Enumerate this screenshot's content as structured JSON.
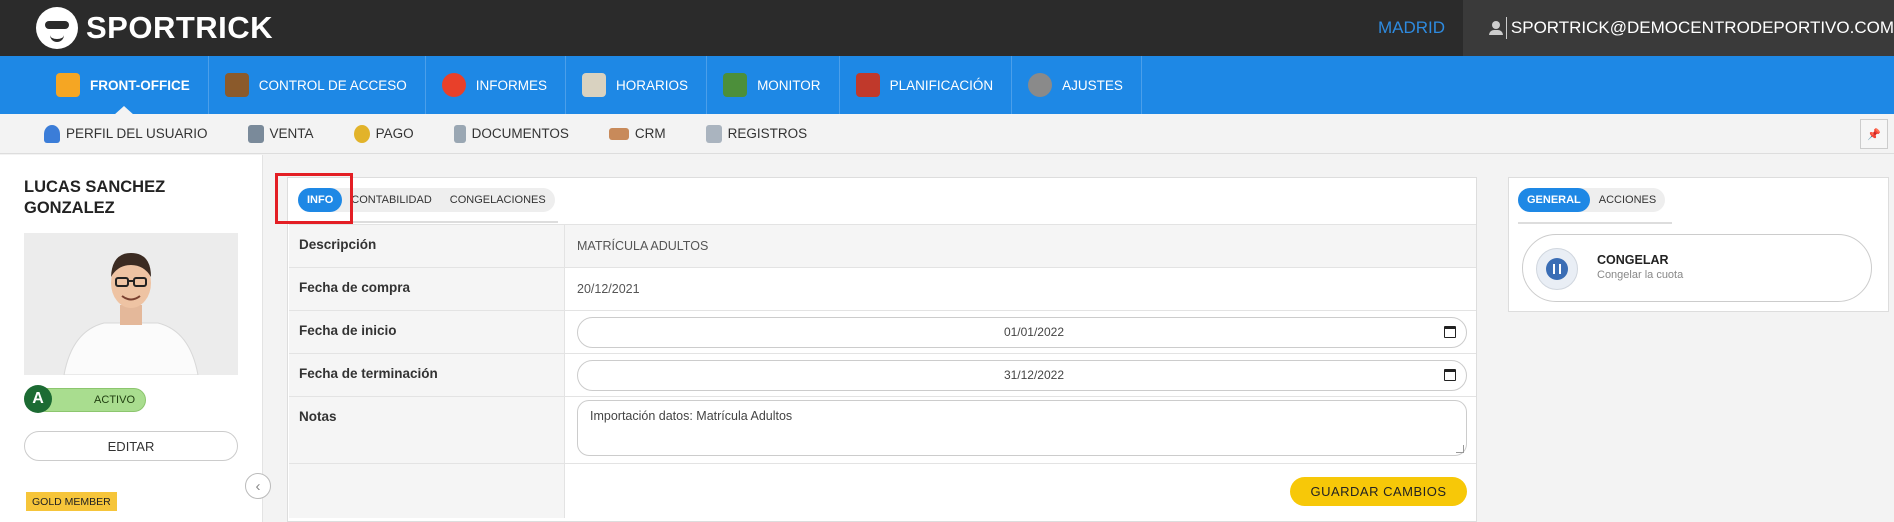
{
  "header": {
    "brand": "SPORTRICK",
    "city": "MADRID",
    "user_email": "SPORTRICK@DEMOCENTRODEPORTIVO.COM"
  },
  "main_nav": [
    {
      "label": "FRONT-OFFICE",
      "icon": "front-office-icon",
      "color": "#f5a623",
      "active": true
    },
    {
      "label": "CONTROL DE ACCESO",
      "icon": "access-control-icon",
      "color": "#8b5a2b",
      "active": false
    },
    {
      "label": "INFORMES",
      "icon": "reports-icon",
      "color": "#e8402a",
      "active": false
    },
    {
      "label": "HORARIOS",
      "icon": "schedule-icon",
      "color": "#d9d2c0",
      "active": false
    },
    {
      "label": "MONITOR",
      "icon": "monitor-icon",
      "color": "#4c8f3a",
      "active": false
    },
    {
      "label": "PLANIFICACIÓN",
      "icon": "calendar-icon",
      "color": "#c0392b",
      "active": false
    },
    {
      "label": "AJUSTES",
      "icon": "settings-icon",
      "color": "#8a8a8a",
      "active": false
    }
  ],
  "sub_nav": [
    {
      "label": "PERFIL DEL USUARIO",
      "icon": "user-profile-icon",
      "color": "#3b7dd8"
    },
    {
      "label": "VENTA",
      "icon": "cash-register-icon",
      "color": "#7a8a9a"
    },
    {
      "label": "PAGO",
      "icon": "coins-icon",
      "color": "#e2b32a"
    },
    {
      "label": "DOCUMENTOS",
      "icon": "documents-icon",
      "color": "#9aa7b3"
    },
    {
      "label": "CRM",
      "icon": "handshake-icon",
      "color": "#c88a5a"
    },
    {
      "label": "REGISTROS",
      "icon": "log-icon",
      "color": "#aab4bf"
    }
  ],
  "profile": {
    "name": "LUCAS SANCHEZ GONZALEZ",
    "status_letter": "A",
    "status_label": "ACTIVO",
    "edit_label": "EDITAR",
    "badge": "GOLD MEMBER"
  },
  "detail": {
    "tabs": [
      {
        "label": "INFO",
        "active": true
      },
      {
        "label": "CONTABILIDAD",
        "active": false
      },
      {
        "label": "CONGELACIONES",
        "active": false
      }
    ],
    "fields": {
      "description_label": "Descripción",
      "description_value": "MATRÍCULA ADULTOS",
      "purchase_label": "Fecha de compra",
      "purchase_value": "20/12/2021",
      "start_label": "Fecha de inicio",
      "start_value": "01/01/2022",
      "end_label": "Fecha de terminación",
      "end_value": "31/12/2022",
      "notes_label": "Notas",
      "notes_value": "Importación datos: Matrícula Adultos"
    },
    "save_label": "GUARDAR CAMBIOS"
  },
  "actions_panel": {
    "tabs": [
      {
        "label": "GENERAL",
        "active": true
      },
      {
        "label": "ACCIONES",
        "active": false
      }
    ],
    "freeze_title": "CONGELAR",
    "freeze_subtitle": "Congelar la cuota"
  }
}
